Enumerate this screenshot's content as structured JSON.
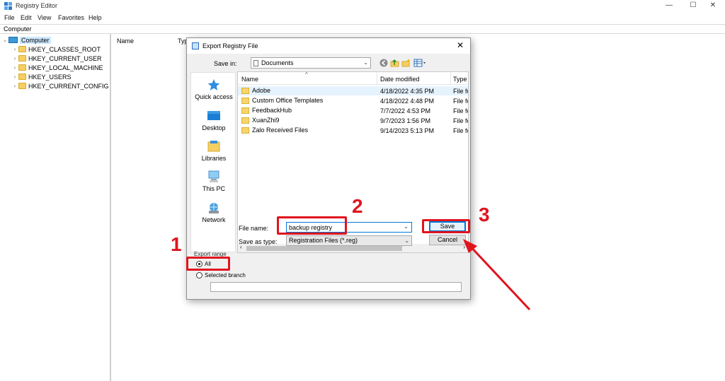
{
  "window": {
    "title": "Registry Editor",
    "minimize": "—",
    "maximize": "☐",
    "close": "✕"
  },
  "menu": [
    "File",
    "Edit",
    "View",
    "Favorites",
    "Help"
  ],
  "address": "Computer",
  "tree": {
    "root": "Computer",
    "items": [
      "HKEY_CLASSES_ROOT",
      "HKEY_CURRENT_USER",
      "HKEY_LOCAL_MACHINE",
      "HKEY_USERS",
      "HKEY_CURRENT_CONFIG"
    ]
  },
  "list": {
    "col_name": "Name",
    "col_type": "Typ"
  },
  "dialog": {
    "title": "Export Registry File",
    "close": "✕",
    "save_in_label": "Save in:",
    "save_in_value": "Documents",
    "places": [
      "Quick access",
      "Desktop",
      "Libraries",
      "This PC",
      "Network"
    ],
    "columns": {
      "name": "Name",
      "date": "Date modified",
      "type": "Type"
    },
    "files": [
      {
        "name": "Adobe",
        "date": "4/18/2022 4:35 PM",
        "type": "File fo"
      },
      {
        "name": "Custom Office Templates",
        "date": "4/18/2022 4:48 PM",
        "type": "File fo"
      },
      {
        "name": "FeedbackHub",
        "date": "7/7/2022 4:53 PM",
        "type": "File fo"
      },
      {
        "name": "XuanZhi9",
        "date": "9/7/2023 1:56 PM",
        "type": "File fo"
      },
      {
        "name": "Zalo Received Files",
        "date": "9/14/2023 5:13 PM",
        "type": "File fo"
      }
    ],
    "file_name_label": "File name:",
    "file_name_value": "backup registry",
    "save_type_label": "Save as type:",
    "save_type_value": "Registration Files (*.reg)",
    "save_button": "Save",
    "cancel_button": "Cancel",
    "export_range_label": "Export range",
    "range_all": "All",
    "range_branch": "Selected branch"
  },
  "annotations": {
    "step1": "1",
    "step2": "2",
    "step3": "3"
  },
  "colors": {
    "annotation": "#e0141e",
    "selection": "#cce8ff",
    "accent": "#0078d7"
  }
}
